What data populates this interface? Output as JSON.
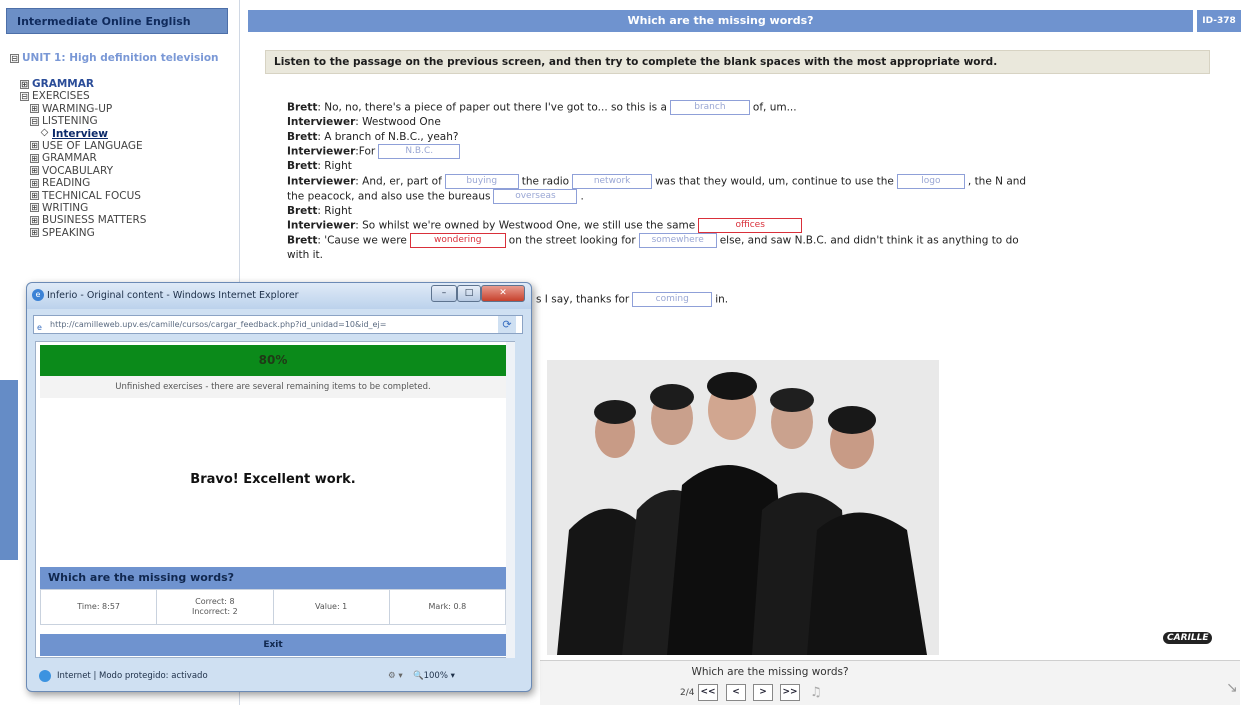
{
  "course_title": "Intermediate Online English",
  "tree": [
    {
      "label": "UNIT 1: High definition television",
      "level": 1,
      "toggle": "⊟",
      "style": "unit"
    },
    {
      "label": "GRAMMAR",
      "level": 2,
      "toggle": "⊞",
      "style": "bold-blue"
    },
    {
      "label": "EXERCISES",
      "level": 2,
      "toggle": "⊟",
      "style": ""
    },
    {
      "label": "WARMING-UP",
      "level": 3,
      "toggle": "⊞",
      "style": ""
    },
    {
      "label": "LISTENING",
      "level": 3,
      "toggle": "⊟",
      "style": ""
    },
    {
      "label": "Interview",
      "level": 4,
      "toggle": "◇",
      "style": "active-link"
    },
    {
      "label": "USE OF LANGUAGE",
      "level": 3,
      "toggle": "⊞",
      "style": ""
    },
    {
      "label": "GRAMMAR",
      "level": 3,
      "toggle": "⊞",
      "style": ""
    },
    {
      "label": "VOCABULARY",
      "level": 3,
      "toggle": "⊞",
      "style": ""
    },
    {
      "label": "READING",
      "level": 3,
      "toggle": "⊞",
      "style": ""
    },
    {
      "label": "TECHNICAL FOCUS",
      "level": 3,
      "toggle": "⊞",
      "style": ""
    },
    {
      "label": "WRITING",
      "level": 3,
      "toggle": "⊞",
      "style": ""
    },
    {
      "label": "BUSINESS MATTERS",
      "level": 3,
      "toggle": "⊞",
      "style": ""
    },
    {
      "label": "SPEAKING",
      "level": 3,
      "toggle": "⊞",
      "style": ""
    }
  ],
  "main": {
    "title": "Which are the missing words?",
    "page_id": "ID-378",
    "instruction": "Listen to the passage on the previous screen, and then try to complete the blank spaces with the most appropriate word."
  },
  "passage": {
    "l1_sp": "Brett",
    "l1_a": ": No, no, there's a piece of paper out there I've got to... so this is a",
    "l1_b1": "branch",
    "l1_c": "of, um...",
    "l2_sp": "Interviewer",
    "l2_a": ": Westwood One",
    "l3_sp": "Brett",
    "l3_a": ": A branch of N.B.C., yeah?",
    "l4_sp": "Interviewer",
    "l4_a": ":For",
    "l4_b1": "N.B.C.",
    "l5_sp": "Brett",
    "l5_a": ": Right",
    "l6_sp": "Interviewer",
    "l6_a": ": And, er, part of",
    "l6_b1": "buying",
    "l6_b": "the radio",
    "l6_b2": "network",
    "l6_c": "was that they would, um, continue to use the",
    "l6_b3": "logo",
    "l6_d": ", the N and",
    "l7_a": "the peacock, and also use the bureaus",
    "l7_b1": "overseas",
    "l7_c": ".",
    "l8_sp": "Brett",
    "l8_a": ": Right",
    "l9_sp": "Interviewer",
    "l9_a": ": So whilst we're owned by Westwood One, we still use the same",
    "l9_b1": "offices",
    "l10_sp": "Brett",
    "l10_a": ": 'Cause we were",
    "l10_b1": "wondering",
    "l10_b": "on the street looking for",
    "l10_b2": "somewhere",
    "l10_c": "else, and saw N.B.C. and didn't think it as anything to do",
    "l11_a": "with it.",
    "l12_a": "s I say, thanks for",
    "l12_b1": "coming",
    "l12_c": "in."
  },
  "bottom": {
    "title": "Which are the missing words?",
    "page": "2/4",
    "first": "<<",
    "prev": "<",
    "next": ">",
    "last": ">>",
    "logo": "CARILLE"
  },
  "popup": {
    "window_title": "Inferio - Original content - Windows Internet Explorer",
    "address": "http://camilleweb.upv.es/camille/cursos/cargar_feedback.php?id_unidad=10&id_ej=",
    "minimize": "–",
    "maximize": "□",
    "close": "✕",
    "score": "80%",
    "status": "Unfinished exercises - there are several remaining items to be completed.",
    "message": "Bravo! Excellent work.",
    "summary_title": "Which are the missing words?",
    "time": "Time: 8:57",
    "correct": "Correct: 8",
    "incorrect": "Incorrect: 2",
    "value": "Value: 1",
    "mark": "Mark: 0.8",
    "exit": "Exit",
    "statusbar": "Internet | Modo protegido: activado",
    "zoom": "100%"
  }
}
